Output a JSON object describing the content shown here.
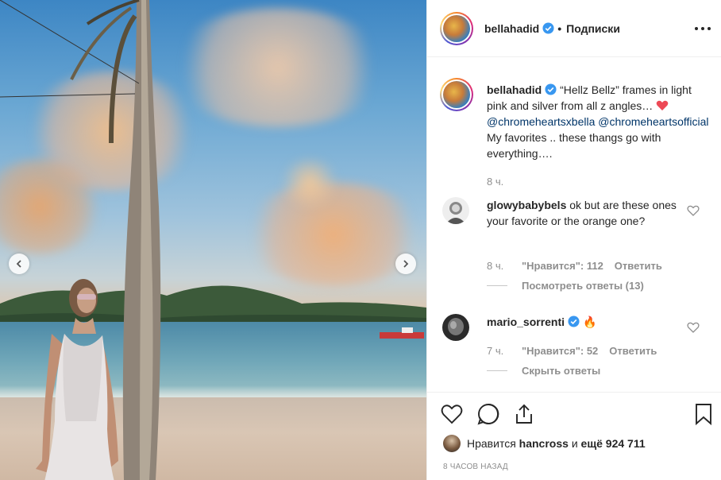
{
  "post": {
    "author": "bellahadid",
    "follow_state": "Подписки",
    "separator": "•"
  },
  "caption": {
    "author": "bellahadid",
    "text_1": "“Hellz Bellz” frames in light pink and silver from all z angles…",
    "mention_1": "@chromeheartsxbella",
    "mention_2": "@chromeheartsofficial",
    "text_2": "My favorites .. these thangs go with everything….",
    "time": "8 ч."
  },
  "comments": [
    {
      "user": "glowybabybels",
      "text": "ok but are these ones your favorite or the orange one?",
      "time": "8 ч.",
      "likes": "\"Нравится\": 112",
      "reply": "Ответить",
      "replies_toggle": "Посмотреть ответы (13)"
    },
    {
      "user": "mario_sorrenti",
      "text": "🔥",
      "time": "7 ч.",
      "likes": "\"Нравится\": 52",
      "reply": "Ответить",
      "replies_toggle": "Скрыть ответы"
    }
  ],
  "likes_row": {
    "prefix": "Нравится",
    "user": "hancross",
    "middle": "и",
    "rest": "ещё 924 711"
  },
  "posted_ago": "8 ЧАСОВ НАЗАД",
  "icons": {
    "verified": "verified-badge-icon",
    "more": "more-options-icon",
    "like": "heart-icon",
    "comment": "comment-icon",
    "share": "share-icon",
    "save": "bookmark-icon",
    "prev": "chevron-left-icon",
    "next": "chevron-right-icon"
  },
  "colors": {
    "verified_blue": "#3897f0",
    "link": "#003569",
    "muted": "#8e8e8e",
    "heart_red": "#ed4956"
  }
}
